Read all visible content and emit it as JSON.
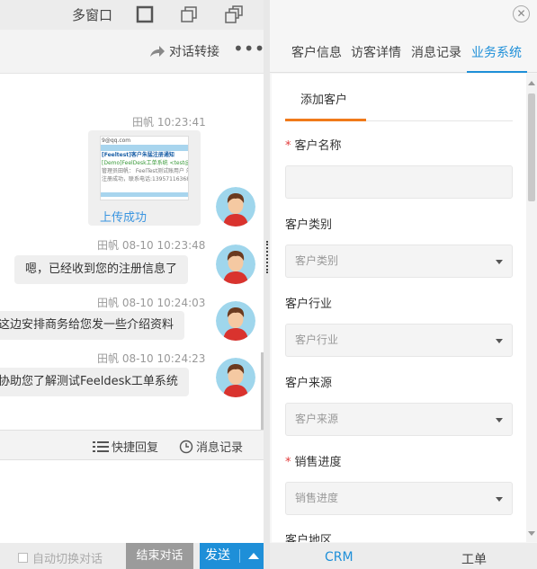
{
  "window": {
    "multi_window_label": "多窗口"
  },
  "chat_header": {
    "transfer_label": "对话转接",
    "more_label": "•••"
  },
  "messages": [
    {
      "meta": "田帆  10:23:41",
      "type": "image",
      "caption": "上传成功",
      "thumb_lines": [
        "9@qq.com",
        "[Feeltest]客户朱猛注册通知",
        "[Demo]FeelDesk工单系统 <test@fe",
        "管理员田帆： FeelTest测试账用户 朱",
        "注册成功，联系电话:13957116368,"
      ]
    },
    {
      "meta": "田帆  08-10 10:23:48",
      "type": "text",
      "text": "嗯，已经收到您的注册信息了"
    },
    {
      "meta": "田帆  08-10 10:24:03",
      "type": "text",
      "text": "这边安排商务给您发一些介绍资料"
    },
    {
      "meta": "田帆  08-10 10:24:23",
      "type": "text",
      "text": "协助您了解测试Feeldesk工单系统"
    }
  ],
  "quickbar": {
    "quick_reply": "快捷回复",
    "msg_history": "消息记录"
  },
  "footer": {
    "auto_switch": "自动切换对话",
    "end_chat": "结束对话",
    "send": "发送"
  },
  "right_tabs": [
    {
      "label": "客户信息",
      "active": false
    },
    {
      "label": "访客详情",
      "active": false
    },
    {
      "label": "消息记录",
      "active": false
    },
    {
      "label": "业务系统",
      "active": true
    }
  ],
  "form": {
    "subtab": "添加客户",
    "customer_name": {
      "label": "客户名称",
      "required": true,
      "value": ""
    },
    "customer_type": {
      "label": "客户类别",
      "placeholder": "客户类别"
    },
    "customer_industry": {
      "label": "客户行业",
      "placeholder": "客户行业"
    },
    "customer_source": {
      "label": "客户来源",
      "placeholder": "客户来源"
    },
    "sales_progress": {
      "label": "销售进度",
      "required": true,
      "placeholder": "销售进度"
    },
    "customer_region": {
      "label": "客户地区"
    }
  },
  "right_footer": {
    "crm": "CRM",
    "ticket": "工单"
  },
  "colors": {
    "accent_blue": "#1e8fd8",
    "accent_orange": "#f07a1a",
    "required_red": "#e23b3b",
    "end_button_gray": "#9b9b9b"
  }
}
